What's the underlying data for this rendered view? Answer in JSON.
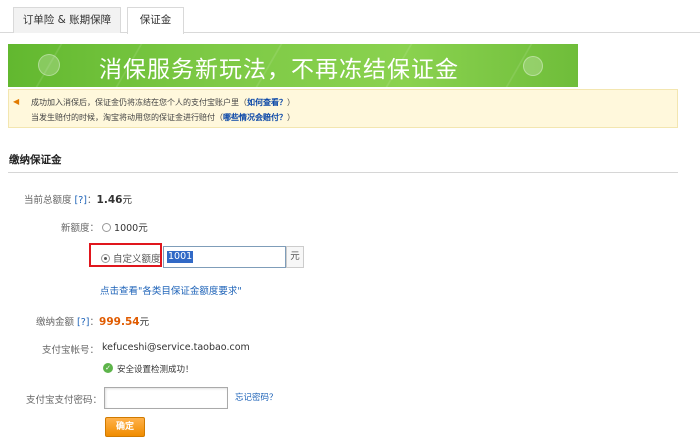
{
  "tabs": [
    {
      "label": "订单险 & 账期保障"
    },
    {
      "label": "保证金"
    }
  ],
  "banner": {
    "text": "消保服务新玩法，不再冻结保证金"
  },
  "notice": {
    "line1_text": "成功加入消保后，保证金仍将冻结在您个人的支付宝账户里（",
    "line1_link": "如何查看？",
    "line1_tail": "）",
    "line2_text": "当发生赔付的时候，淘宝将动用您的保证金进行赔付（",
    "line2_link": "哪些情况会赔付？",
    "line2_tail": "）"
  },
  "section": {
    "title": "缴纳保证金"
  },
  "form": {
    "current_total_label": "当前总额度",
    "help_mark": "[?]",
    "colon": "：",
    "current_total_value": "1.46",
    "yuan": "元",
    "new_quota_label": "新额度：",
    "option_1000": "1000元",
    "custom_label": "自定义额度",
    "custom_value": "1001",
    "custom_unit": "元",
    "requirements_link": "点击查看\"各类目保证金额度要求\"",
    "pay_amount_label": "缴纳金额",
    "pay_amount_value": "999.54",
    "alipay_account_label": "支付宝帐号：",
    "alipay_account_value": "kefuceshi@service.taobao.com",
    "security_ok": "安全设置检测成功！",
    "password_label": "支付宝支付密码：",
    "forgot_password": "忘记密码？",
    "confirm_button": "确定"
  },
  "colors": {
    "accent_orange": "#e05b00",
    "link_blue": "#1e63b8",
    "banner_green": "#7dc945",
    "highlight_red": "#e0161d"
  }
}
